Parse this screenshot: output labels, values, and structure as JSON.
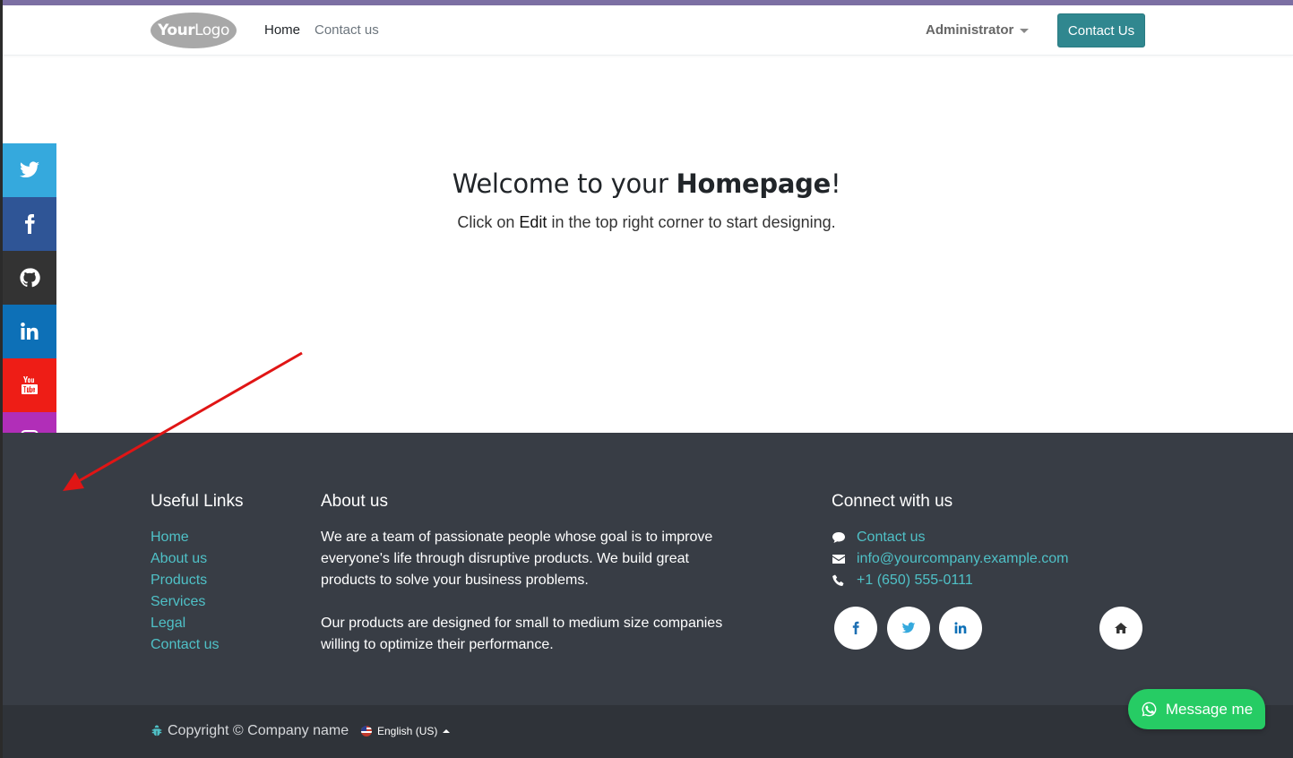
{
  "header": {
    "logo_text_bold": "Your",
    "logo_text_light": "Logo",
    "nav": [
      {
        "label": "Home",
        "active": true
      },
      {
        "label": "Contact us",
        "active": false
      }
    ],
    "user_menu": "Administrator",
    "cta_button": "Contact Us"
  },
  "hero": {
    "title_prefix": "Welcome to your ",
    "title_bold": "Homepage",
    "title_suffix": "!",
    "subtitle_prefix": "Click on ",
    "subtitle_bold": "Edit",
    "subtitle_suffix": " in the top right corner to start designing."
  },
  "social_sidebar": [
    {
      "icon": "twitter-icon",
      "color": "#35a9dd"
    },
    {
      "icon": "facebook-icon",
      "color": "#2f5596"
    },
    {
      "icon": "github-icon",
      "color": "#333333"
    },
    {
      "icon": "linkedin-icon",
      "color": "#0d70b7"
    },
    {
      "icon": "youtube-icon",
      "color": "#ee1d16"
    },
    {
      "icon": "instagram-icon",
      "color": "#b12eb8"
    },
    {
      "icon": "arrow-left-icon",
      "color": "#333333"
    }
  ],
  "footer": {
    "useful_links_title": "Useful Links",
    "useful_links": [
      "Home",
      "About us",
      "Products",
      "Services",
      "Legal",
      "Contact us"
    ],
    "about_title": "About us",
    "about_p1": "We are a team of passionate people whose goal is to improve everyone's life through disruptive products. We build great products to solve your business problems.",
    "about_p2": "Our products are designed for small to medium size companies willing to optimize their performance.",
    "connect_title": "Connect with us",
    "connect_items": [
      {
        "icon": "comment-icon",
        "label": "Contact us"
      },
      {
        "icon": "envelope-icon",
        "label": "info@yourcompany.example.com"
      },
      {
        "icon": "phone-icon",
        "label": "+1 (650) 555-0111"
      }
    ],
    "social_buttons": [
      "facebook-icon",
      "twitter-icon",
      "linkedin-icon",
      "home-icon"
    ]
  },
  "bottom_bar": {
    "copyright": "Copyright © Company name",
    "language": "English (US)"
  },
  "chat_button": "Message me",
  "colors": {
    "accent": "#30878f",
    "link": "#4fc1c7",
    "footer_bg": "#383d45",
    "whatsapp": "#26cc64",
    "annotation_arrow": "#e01515"
  }
}
